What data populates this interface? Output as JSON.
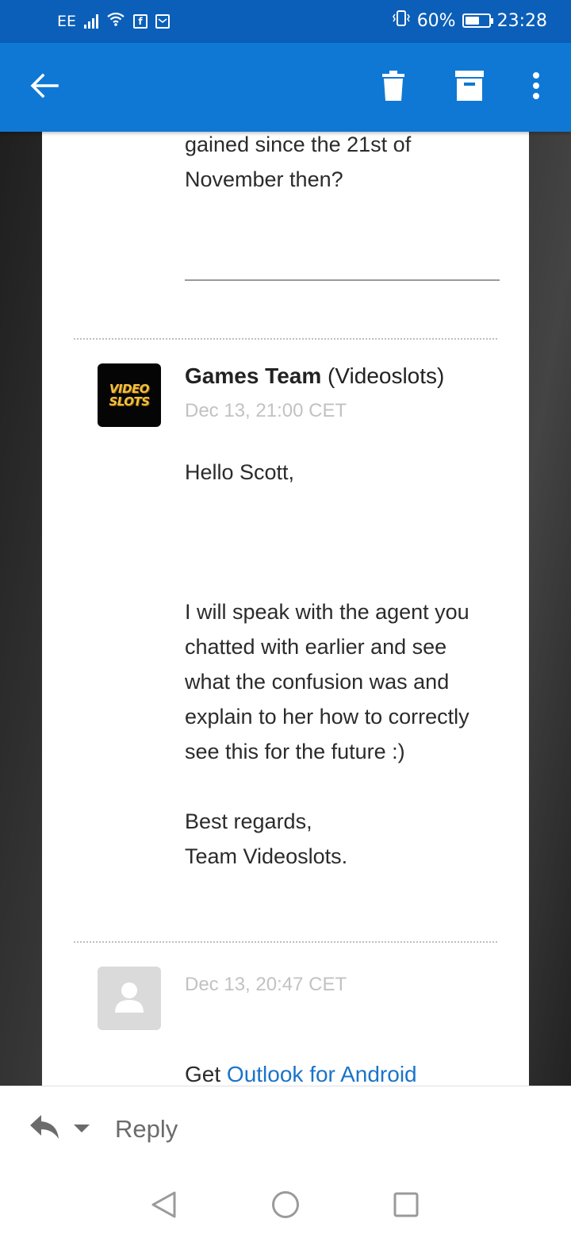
{
  "status_bar": {
    "carrier": "EE",
    "battery_percent": "60%",
    "battery_level": 0.6,
    "time": "23:28"
  },
  "toolbar": {
    "back_icon": "arrow-left-icon",
    "delete_icon": "trash-icon",
    "archive_icon": "archive-icon",
    "more_icon": "more-vertical-icon"
  },
  "previous_message": {
    "lines": [
      "gained since the 21st of",
      "November then?"
    ]
  },
  "message_1": {
    "sender_name": "Games Team",
    "sender_org": "(Videoslots)",
    "timestamp": "Dec 13, 21:00 CET",
    "greeting": "Hello Scott,",
    "body_lines": [
      "I will speak with the agent you",
      "chatted with earlier and see",
      "what the confusion was and",
      "explain to her how to correctly",
      "see this for the future :)"
    ],
    "signoff": "Best regards,",
    "signature": "Team Videoslots."
  },
  "videoslots_logo_text": [
    "VIDEO",
    "SLOTS"
  ],
  "message_2": {
    "timestamp": "Dec 13, 20:47 CET",
    "get_text": "Get",
    "link_text": "Outlook for Android"
  },
  "reply_bar": {
    "label": "Reply"
  },
  "colors": {
    "status_bar": "#0b5fb8",
    "app_bar": "#0f78d4",
    "link": "#1a74c9"
  }
}
